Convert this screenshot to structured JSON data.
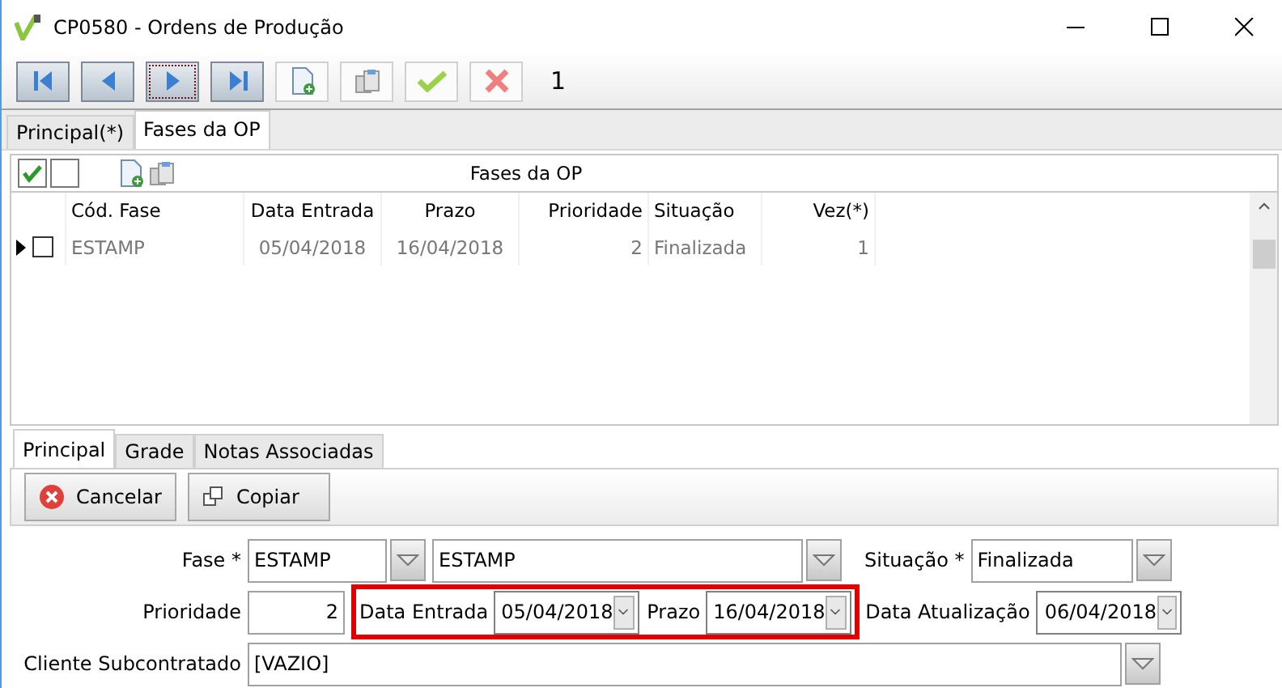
{
  "window": {
    "title": "CP0580 - Ordens de Produção"
  },
  "toolbar": {
    "buttons": [
      {
        "kind": "first",
        "focused": false
      },
      {
        "kind": "prev",
        "focused": false
      },
      {
        "kind": "next",
        "focused": true
      },
      {
        "kind": "last",
        "focused": false
      },
      {
        "kind": "new",
        "focused": false
      },
      {
        "kind": "copy",
        "focused": false
      },
      {
        "kind": "confirm",
        "focused": false
      },
      {
        "kind": "cancel",
        "focused": false
      }
    ],
    "record": "1"
  },
  "tabs": [
    {
      "label": "Principal(*)",
      "selected": false
    },
    {
      "label": "Fases da OP",
      "selected": true
    }
  ],
  "grid": {
    "caption": "Fases da OP",
    "columns": [
      {
        "label": "Cód. Fase"
      },
      {
        "label": "Data Entrada"
      },
      {
        "label": "Prazo"
      },
      {
        "label": "Prioridade"
      },
      {
        "label": "Situação"
      },
      {
        "label": "Vez(*)"
      }
    ],
    "rows": [
      {
        "checked": false,
        "current": true,
        "cells": [
          "ESTAMP",
          "05/04/2018",
          "16/04/2018",
          "2",
          "Finalizada",
          "1"
        ]
      }
    ]
  },
  "detail_tabs": [
    {
      "label": "Principal",
      "selected": true
    },
    {
      "label": "Grade",
      "selected": false
    },
    {
      "label": "Notas Associadas",
      "selected": false
    }
  ],
  "actions": [
    {
      "kind": "cancel",
      "label": "Cancelar"
    },
    {
      "kind": "copy",
      "label": "Copiar"
    }
  ],
  "form": {
    "fase_label": "Fase *",
    "fase_code": "ESTAMP",
    "fase_name": "ESTAMP",
    "situacao_label": "Situação *",
    "situacao": "Finalizada",
    "prioridade_label": "Prioridade",
    "prioridade": "2",
    "data_entrada_label": "Data Entrada",
    "data_entrada": "05/04/2018",
    "prazo_label": "Prazo",
    "prazo": "16/04/2018",
    "data_atualizacao_label": "Data Atualização",
    "data_atualizacao": "06/04/2018",
    "cliente_label": "Cliente Subcontratado",
    "cliente": "[VAZIO]"
  }
}
